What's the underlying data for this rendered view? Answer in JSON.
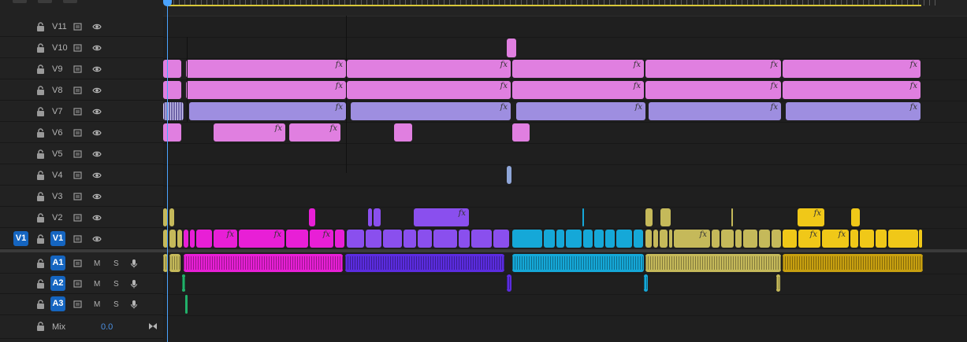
{
  "tracks": {
    "video": [
      {
        "name": "V11"
      },
      {
        "name": "V10"
      },
      {
        "name": "V9"
      },
      {
        "name": "V8"
      },
      {
        "name": "V7"
      },
      {
        "name": "V6"
      },
      {
        "name": "V5"
      },
      {
        "name": "V4"
      },
      {
        "name": "V3"
      },
      {
        "name": "V2"
      },
      {
        "name": "V1",
        "source": "V1"
      }
    ],
    "audio": [
      {
        "name": "A1",
        "m": "M",
        "s": "S"
      },
      {
        "name": "A2",
        "m": "M",
        "s": "S"
      },
      {
        "name": "A3",
        "m": "M",
        "s": "S"
      }
    ],
    "mix": {
      "label": "Mix",
      "value": "0.0"
    }
  },
  "fx_label": "fx",
  "colors": {
    "pink": "#e07fe0",
    "lavender": "#9e8ee0",
    "magenta": "#e81fd6",
    "purple": "#8a4fee",
    "cyan": "#15a8d8",
    "olive": "#c5b95a",
    "yellow": "#f0c818",
    "blue_badge": "#1565c0",
    "playhead": "#4aa3ff"
  },
  "icons": [
    "lock-icon",
    "sync-lock-icon",
    "eye-icon",
    "mic-icon",
    "mix-end-icon"
  ]
}
